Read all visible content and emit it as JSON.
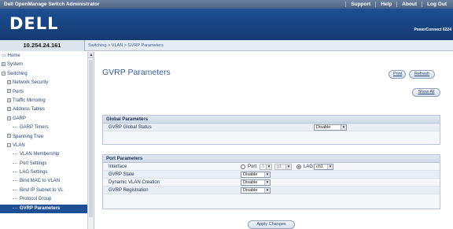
{
  "topbar": {
    "title": "Dell OpenManage Switch Administrator",
    "links": [
      "Support",
      "Help",
      "About",
      "Log Out"
    ]
  },
  "header": {
    "logo": "DELL",
    "product": "PowerConnect 6224"
  },
  "breadcrumb": {
    "ip": "10.254.24.161",
    "path": "Switching > VLAN > GVRP Parameters"
  },
  "sidebar": {
    "items": [
      {
        "label": "Home",
        "depth": 0,
        "expander": ""
      },
      {
        "label": "System",
        "depth": 0,
        "expander": "+"
      },
      {
        "label": "Switching",
        "depth": 0,
        "expander": "−"
      },
      {
        "label": "Network Security",
        "depth": 1,
        "expander": "+"
      },
      {
        "label": "Ports",
        "depth": 1,
        "expander": "+"
      },
      {
        "label": "Traffic Mirroring",
        "depth": 1,
        "expander": "+"
      },
      {
        "label": "Address Tables",
        "depth": 1,
        "expander": "+"
      },
      {
        "label": "GARP",
        "depth": 1,
        "expander": "−"
      },
      {
        "label": "GARP Timers",
        "depth": 2,
        "expander": ""
      },
      {
        "label": "Spanning Tree",
        "depth": 1,
        "expander": "+"
      },
      {
        "label": "VLAN",
        "depth": 1,
        "expander": "−"
      },
      {
        "label": "VLAN Membership",
        "depth": 2,
        "expander": ""
      },
      {
        "label": "Port Settings",
        "depth": 2,
        "expander": ""
      },
      {
        "label": "LAG Settings",
        "depth": 2,
        "expander": ""
      },
      {
        "label": "Bind MAC to VLAN",
        "depth": 2,
        "expander": ""
      },
      {
        "label": "Bind IP Subnet to VL",
        "depth": 2,
        "expander": ""
      },
      {
        "label": "Protocol Group",
        "depth": 2,
        "expander": ""
      },
      {
        "label": "GVRP Parameters",
        "depth": 2,
        "expander": "",
        "active": true
      }
    ]
  },
  "main": {
    "title": "GVRP Parameters",
    "print_label": "Print",
    "refresh_label": "Refresh",
    "show_all_label": "Show All",
    "apply_label": "Apply Changes"
  },
  "global_params": {
    "heading": "Global Parameters",
    "status_label": "GVRP Global Status",
    "status_value": "Disable"
  },
  "port_params": {
    "heading": "Port Parameters",
    "interface_label": "Interface",
    "port_label": "Port",
    "port_unit": "1",
    "port_value": "g1",
    "lag_label": "LAG",
    "lag_value": "ch1",
    "interface_selected": "LAG",
    "gvrp_state_label": "GVRP State",
    "gvrp_state_value": "Disable",
    "dynamic_vlan_label": "Dynamic VLAN Creation",
    "dynamic_vlan_value": "Disable",
    "registration_label": "GVRP Registration",
    "registration_value": "Disable"
  },
  "colors": {
    "brand_blue": "#1c4f93",
    "link_blue": "#3b5f94",
    "panel_bg": "#f4f6f9"
  }
}
